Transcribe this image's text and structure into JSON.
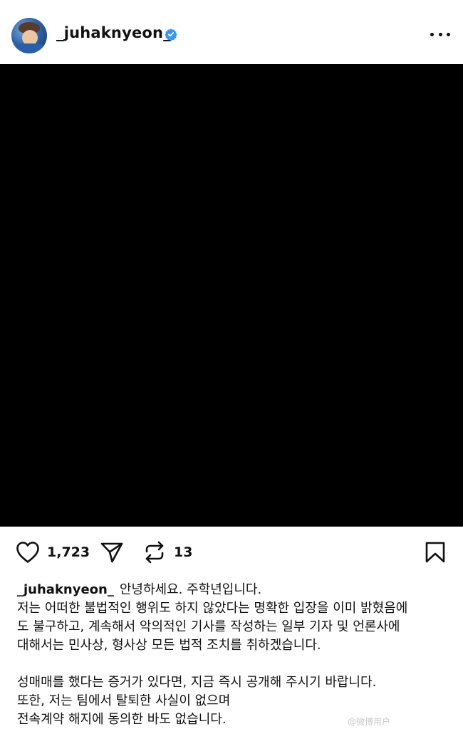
{
  "post": {
    "username": "_juhaknyeon_",
    "verified": true,
    "avatar": "profile-photo",
    "media": "black-image",
    "likes": "1,723",
    "reposts": "13"
  },
  "caption": {
    "username": "_juhaknyeon_",
    "lines": [
      "안녕하세요. 주학년입니다.",
      "저는 어떠한 불법적인 행위도 하지 않았다는 명확한 입장을 이미 밝혔음에",
      "도 불구하고, 계속해서 악의적인 기사를 작성하는 일부 기자 및 언론사에",
      "대해서는 민사상, 형사상 모든 법적 조치를 취하겠습니다.",
      "",
      "성매매를 했다는 증거가 있다면, 지금 즉시 공개해 주시기 바랍니다.",
      "또한, 저는 팀에서 탈퇴한 사실이 없으며",
      "전속계약 해지에 동의한 바도 없습니다."
    ]
  },
  "watermark": "@微博用户",
  "icons": {
    "more": "more-options-icon",
    "like": "heart-icon",
    "share": "send-icon",
    "repost": "repost-icon",
    "save": "bookmark-icon",
    "verified": "verified-badge-icon"
  },
  "colors": {
    "verified_blue": "#3797f0",
    "text": "#111111",
    "media_background": "#000000"
  }
}
